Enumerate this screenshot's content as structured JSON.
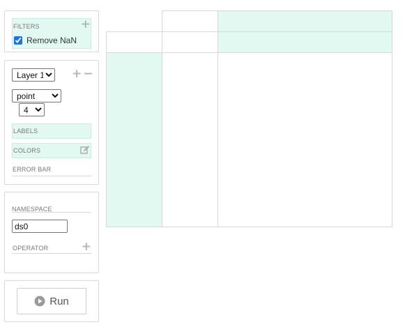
{
  "filters": {
    "title": "FILTERS",
    "remove_nan_label": "Remove NaN",
    "remove_nan_checked": true
  },
  "layer": {
    "selected_layer": "Layer 1",
    "mark_type": "point",
    "size": "4",
    "labels_title": "LABELS",
    "colors_title": "COLORS",
    "error_bar_title": "ERROR BAR"
  },
  "namespace": {
    "title": "NAMESPACE",
    "value": "ds0",
    "operator_title": "OPERATOR"
  },
  "run": {
    "label": "Run"
  },
  "colors": {
    "accent_teal": "#e1f9f1",
    "border": "#d8d8d8"
  }
}
